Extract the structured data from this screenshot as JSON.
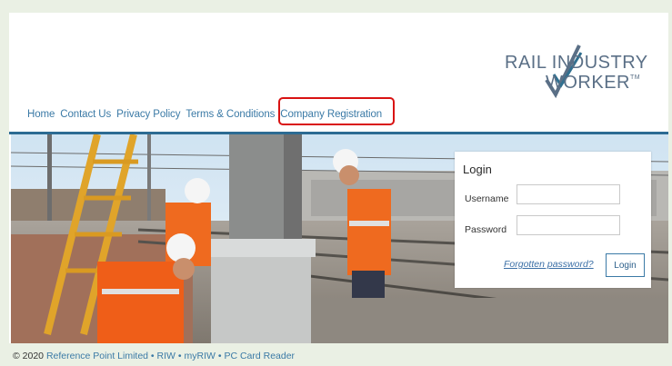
{
  "logo": {
    "line1": "RAIL INDUSTRY",
    "line2": "WORKER",
    "tm": "TM"
  },
  "nav": {
    "items": [
      {
        "label": "Home"
      },
      {
        "label": "Contact Us"
      },
      {
        "label": "Privacy Policy"
      },
      {
        "label": "Terms & Conditions"
      },
      {
        "label": "Company Registration"
      }
    ]
  },
  "login": {
    "title": "Login",
    "username_label": "Username",
    "password_label": "Password",
    "username_value": "",
    "password_value": "",
    "forgot_link": "Forgotten password?",
    "submit_label": "Login"
  },
  "footer": {
    "copyright": "© 2020",
    "links": [
      "Reference Point Limited",
      "RIW",
      "myRIW",
      "PC Card Reader"
    ],
    "separator": "•"
  },
  "colors": {
    "link": "#3b7aa6",
    "rule": "#2c6b93",
    "highlight": "#d91212",
    "background": "#eaf0e4"
  }
}
